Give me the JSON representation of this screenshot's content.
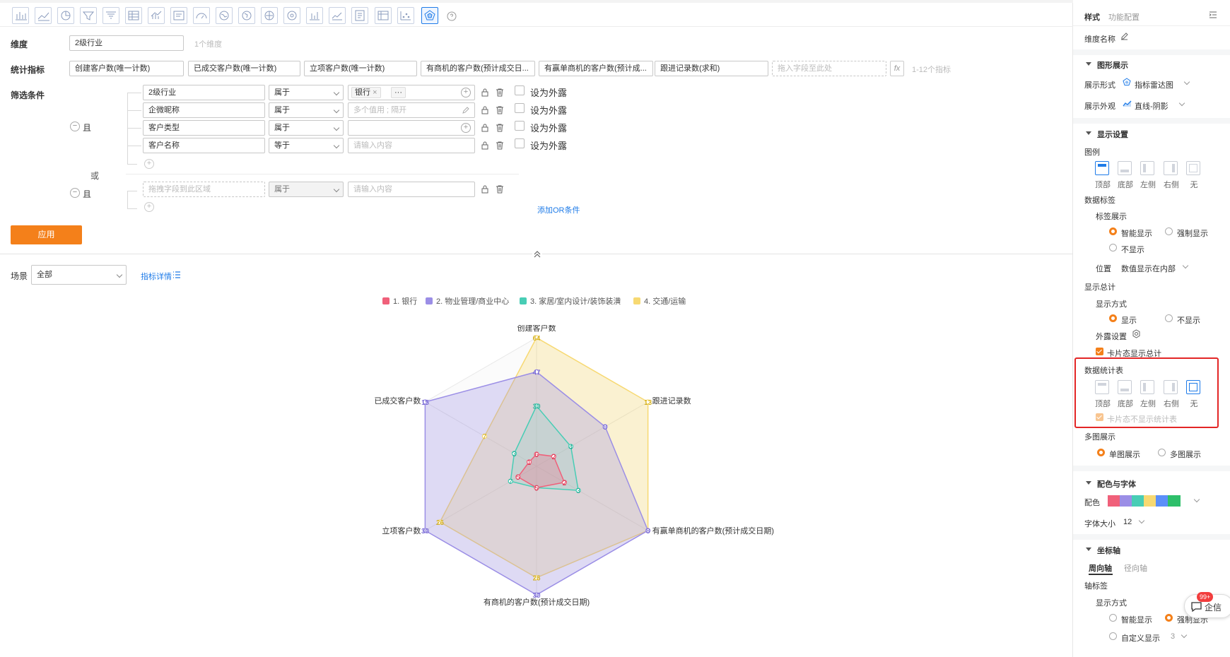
{
  "toolbar": {
    "icons": [
      "bar-chart",
      "line-chart",
      "pie-chart",
      "funnel-chart",
      "funnel-chart-2",
      "table",
      "combo-chart",
      "text-card",
      "gauge",
      "map-1",
      "map-2",
      "map-3",
      "map-4",
      "column-chart",
      "line-chart-2",
      "rich-text",
      "pivot-table",
      "scatter-chart",
      "radar-chart",
      "help"
    ],
    "active_index": 18
  },
  "dimension": {
    "label": "维度",
    "value": "2级行业",
    "hint": "1个维度"
  },
  "metrics": {
    "label": "统计指标",
    "items": [
      "创建客户数(唯一计数)",
      "已成交客户数(唯一计数)",
      "立项客户数(唯一计数)",
      "有商机的客户数(预计成交日...",
      "有赢单商机的客户数(预计成...",
      "跟进记录数(求和)"
    ],
    "drop_placeholder": "拖入字段至此处",
    "fx": "fx",
    "hint": "1-12个指标"
  },
  "filter": {
    "label": "筛选条件",
    "and_label": "且",
    "or_label": "或",
    "rows": [
      {
        "field": "2级行业",
        "op": "属于",
        "tag": "银行",
        "tag_close": "×",
        "more": "···",
        "placeholder": "",
        "expose": "设为外露"
      },
      {
        "field": "企微昵称",
        "op": "属于",
        "tag": "",
        "placeholder": "多个值用 ; 隔开",
        "expose": "设为外露"
      },
      {
        "field": "客户类型",
        "op": "属于",
        "tag": "",
        "placeholder": "",
        "expose": "设为外露"
      },
      {
        "field": "客户名称",
        "op": "等于",
        "tag": "",
        "placeholder": "请输入内容",
        "expose": "设为外露"
      }
    ],
    "group2": {
      "field_placeholder": "拖拽字段到此区域",
      "op": "属于",
      "value_placeholder": "请输入内容"
    },
    "add_or": "添加OR条件",
    "apply": "应用"
  },
  "scene": {
    "label": "场景",
    "value": "全部",
    "detail_link": "指标详情"
  },
  "chart_data": {
    "type": "radar",
    "axes": [
      "创建客户数",
      "跟进记录数",
      "有赢单商机的客户数(预计成交日期)",
      "有商机的客户数(预计成交日期)",
      "立项客户数",
      "已成交客户数"
    ],
    "series": [
      {
        "name": "1.  银行",
        "color": "#f0607a",
        "values": [
          6,
          2,
          2,
          5,
          5,
          1
        ]
      },
      {
        "name": "2.  物业管理/商业中心",
        "color": "#9b8ee6",
        "values": [
          47,
          8,
          8,
          30,
          30,
          15
        ]
      },
      {
        "name": "3.  家居/室内设计/装饰装潢",
        "color": "#48cdb5",
        "values": [
          30,
          4,
          3,
          5,
          7,
          3
        ]
      },
      {
        "name": "4.  交通/运输",
        "color": "#f7d972",
        "values": [
          64,
          13,
          8,
          26,
          26,
          7
        ]
      }
    ],
    "labels": [
      {
        "text": "64",
        "color": "#c9a400"
      },
      {
        "text": "47",
        "color": "#6a5acd"
      },
      {
        "text": "30",
        "color": "#1ea78e"
      },
      {
        "text": "6",
        "color": "#d6334f"
      },
      {
        "text": "13",
        "color": "#c9a400"
      },
      {
        "text": "8",
        "color": "#6a5acd"
      },
      {
        "text": "4",
        "color": "#1ea78e"
      },
      {
        "text": "2",
        "color": "#d6334f"
      },
      {
        "text": "8",
        "color": "#6a5acd"
      },
      {
        "text": "3",
        "color": "#1ea78e"
      },
      {
        "text": "2",
        "color": "#d6334f"
      },
      {
        "text": "30",
        "color": "#6a5acd"
      },
      {
        "text": "26",
        "color": "#c9a400"
      },
      {
        "text": "5",
        "color": "#d6334f"
      },
      {
        "text": "30",
        "color": "#6a5acd"
      },
      {
        "text": "26",
        "color": "#c9a400"
      },
      {
        "text": "7",
        "color": "#1ea78e"
      },
      {
        "text": "5",
        "color": "#d6334f"
      },
      {
        "text": "15",
        "color": "#6a5acd"
      },
      {
        "text": "7",
        "color": "#c9a400"
      },
      {
        "text": "3",
        "color": "#1ea78e"
      },
      {
        "text": "1",
        "color": "#d6334f"
      }
    ]
  },
  "panel": {
    "tabs": [
      "样式",
      "功能配置"
    ],
    "dim_name": "维度名称",
    "graphic": {
      "title": "图形展示",
      "mode_label": "展示形式",
      "mode_value": "指标雷达图",
      "look_label": "展示外观",
      "look_value": "直线-阴影"
    },
    "display": {
      "title": "显示设置",
      "legend": "图例",
      "positions": [
        "顶部",
        "底部",
        "左侧",
        "右侧",
        "无"
      ],
      "legend_selected": 0,
      "data_label": "数据标签",
      "label_show": "标签展示",
      "label_opts": [
        "智能显示",
        "强制显示",
        "不显示"
      ],
      "position_label": "位置",
      "position_value": "数值显示在内部",
      "total": "显示总计",
      "total_mode": "显示方式",
      "total_opts": [
        "显示",
        "不显示"
      ],
      "expose_setting": "外露设置",
      "card_total": "卡片态显示总计",
      "stat_table": "数据统计表",
      "stat_selected": 4,
      "card_no_table": "卡片态不显示统计表",
      "multi": "多图展示",
      "multi_opts": [
        "单图展示",
        "多图展示"
      ]
    },
    "color_font": {
      "title": "配色与字体",
      "palette_label": "配色",
      "palette": [
        "#f0607a",
        "#9b8ee6",
        "#48cdb5",
        "#f7d972",
        "#5b8ff9",
        "#2ebf6a"
      ],
      "font_label": "字体大小",
      "font_value": "12"
    },
    "axis": {
      "title": "坐标轴",
      "tabs": [
        "周向轴",
        "径向轴"
      ],
      "axis_label": "轴标签",
      "mode": "显示方式",
      "opts": [
        "智能显示",
        "强制显示",
        "自定义显示"
      ],
      "custom_value": "3"
    },
    "chat": {
      "label": "企信",
      "badge": "99+"
    }
  }
}
